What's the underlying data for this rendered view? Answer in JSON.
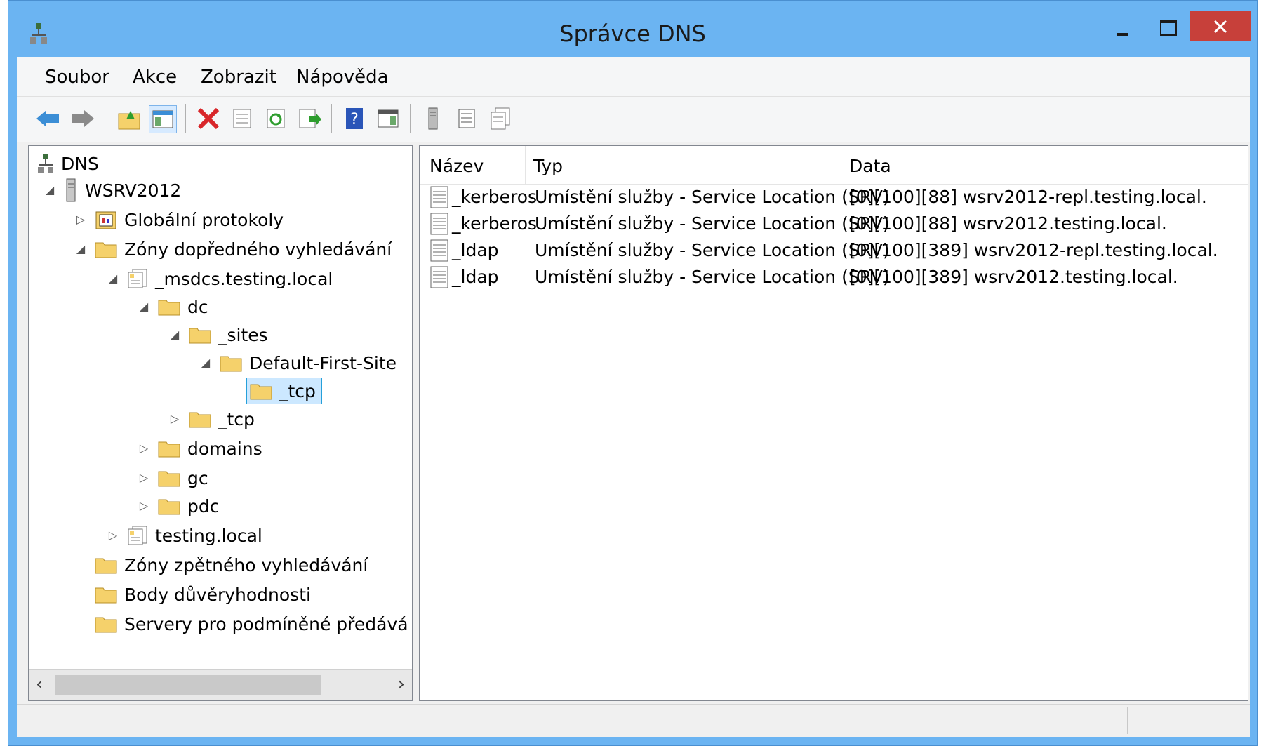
{
  "window": {
    "title": "Správce DNS"
  },
  "menu": [
    {
      "label": "Soubor"
    },
    {
      "label": "Akce"
    },
    {
      "label": "Zobrazit"
    },
    {
      "label": "Nápověda"
    }
  ],
  "toolbar": {
    "icons": [
      "back-arrow-icon",
      "forward-arrow-icon",
      "up-folder-icon",
      "show-hide-tree-icon",
      "delete-icon",
      "properties-icon",
      "refresh-icon",
      "export-list-icon",
      "help-icon",
      "show-hide-action-pane-icon",
      "server-icon",
      "record-list-icon",
      "new-record-icon"
    ]
  },
  "tree": {
    "items": [
      {
        "label": "DNS"
      },
      {
        "label": "WSRV2012"
      },
      {
        "label": "Globální protokoly"
      },
      {
        "label": "Zóny dopředného vyhledávání"
      },
      {
        "label": "_msdcs.testing.local"
      },
      {
        "label": "dc"
      },
      {
        "label": "_sites"
      },
      {
        "label": "Default-First-Site"
      },
      {
        "label": "_tcp"
      },
      {
        "label": "_tcp"
      },
      {
        "label": "domains"
      },
      {
        "label": "gc"
      },
      {
        "label": "pdc"
      },
      {
        "label": "testing.local"
      },
      {
        "label": "Zóny zpětného vyhledávání"
      },
      {
        "label": "Body důvěryhodnosti"
      },
      {
        "label": "Servery pro podmíněné předává"
      }
    ]
  },
  "list": {
    "columns": [
      "Název",
      "Typ",
      "Data"
    ],
    "rows": [
      {
        "name": "_kerberos",
        "type": "Umístění služby - Service Location (SRV)",
        "data": "[0][100][88] wsrv2012-repl.testing.local."
      },
      {
        "name": "_kerberos",
        "type": "Umístění služby - Service Location (SRV)",
        "data": "[0][100][88] wsrv2012.testing.local."
      },
      {
        "name": "_ldap",
        "type": "Umístění služby - Service Location (SRV)",
        "data": "[0][100][389] wsrv2012-repl.testing.local."
      },
      {
        "name": "_ldap",
        "type": "Umístění služby - Service Location (SRV)",
        "data": "[0][100][389] wsrv2012.testing.local."
      }
    ]
  },
  "colors": {
    "titlebar": "#6bb4f2",
    "close": "#c7403a",
    "selection": "#cce8ff",
    "folder": "#f5d16b"
  }
}
